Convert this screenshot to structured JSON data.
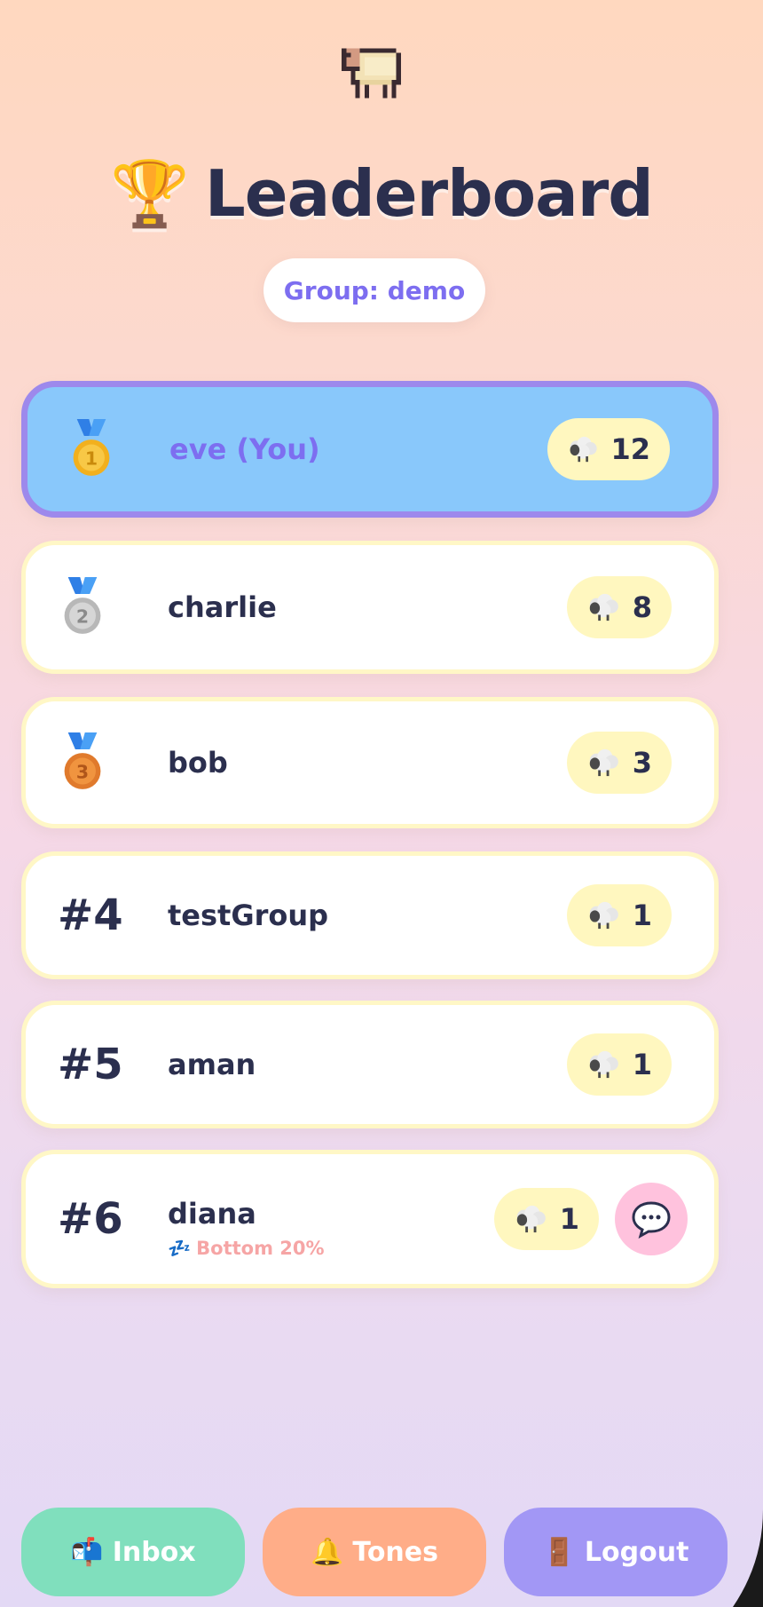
{
  "header": {
    "title": "Leaderboard",
    "group_label": "Group: demo"
  },
  "leaderboard": [
    {
      "rank": "#1",
      "medal": "gold-medal",
      "name": "eve (You)",
      "score": "12",
      "is_current_user": true
    },
    {
      "rank": "#2",
      "medal": "silver-medal",
      "name": "charlie",
      "score": "8"
    },
    {
      "rank": "#3",
      "medal": "bronze-medal",
      "name": "bob",
      "score": "3"
    },
    {
      "rank": "#4",
      "name": "testGroup",
      "score": "1"
    },
    {
      "rank": "#5",
      "name": "aman",
      "score": "1"
    },
    {
      "rank": "#6",
      "name": "diana",
      "score": "1",
      "status": "Bottom 20%",
      "status_icon": "zzz-icon",
      "has_message_button": true
    }
  ],
  "nav": {
    "inbox_label": "Inbox",
    "inbox_icon": "📬",
    "tones_label": "Tones",
    "tones_icon": "🔔",
    "logout_label": "Logout",
    "logout_icon": "🚪"
  },
  "colors": {
    "accent": "#7d6ef0",
    "current_user_bg": "#89c8fb",
    "current_user_border": "#9d89ec",
    "score_pill": "#fff7bf",
    "row_border": "#fff7c6",
    "text_dark": "#2b2f4e",
    "inbox": "#80dfbd",
    "tones": "#ffad88",
    "logout": "#a297f5",
    "message_button": "#ffc2dd",
    "status_text": "#f6a5a5"
  }
}
